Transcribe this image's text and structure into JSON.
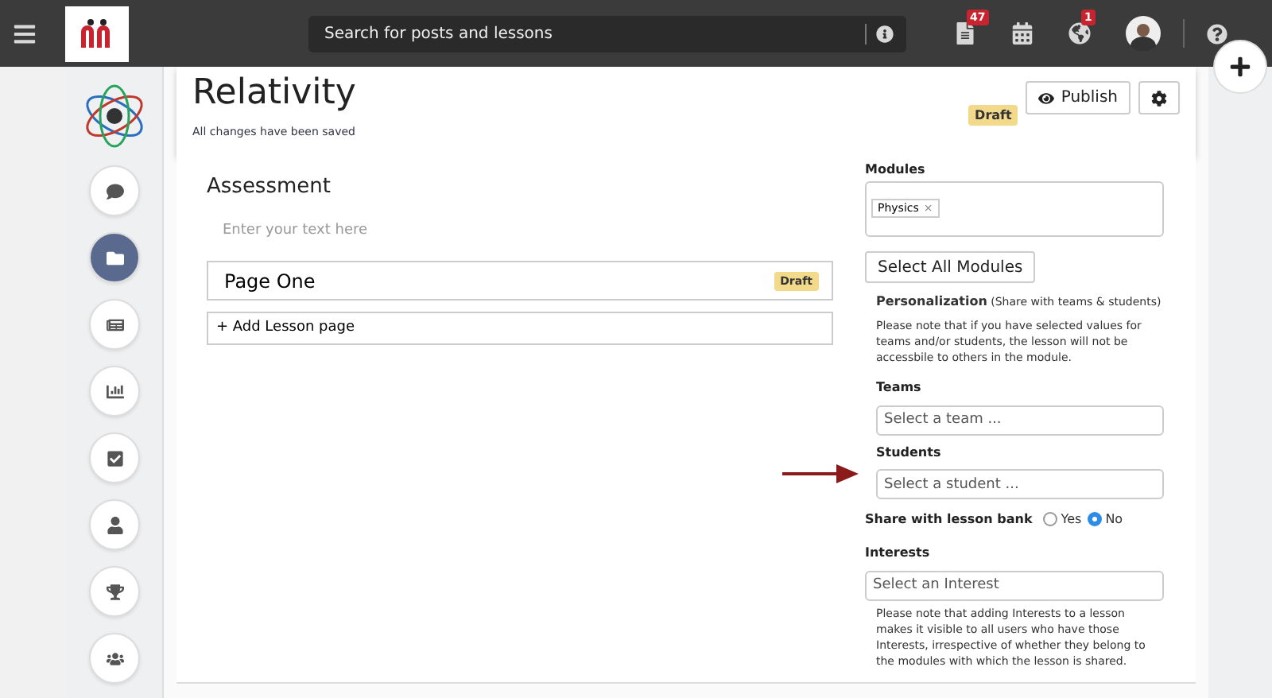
{
  "topbar": {
    "search": {
      "placeholder": "Search for posts and lessons"
    },
    "notifications": [
      {
        "kind": "document",
        "badge": "47"
      },
      {
        "kind": "calendar"
      },
      {
        "kind": "globe",
        "badge": "1"
      }
    ]
  },
  "sidebar": {
    "items": [
      {
        "kind": "chat",
        "selected": false
      },
      {
        "kind": "folder",
        "selected": true
      },
      {
        "kind": "newspaper",
        "selected": false
      },
      {
        "kind": "chart",
        "selected": false
      },
      {
        "kind": "tasks",
        "selected": false
      },
      {
        "kind": "user",
        "selected": false
      },
      {
        "kind": "trophy",
        "selected": false
      },
      {
        "kind": "users",
        "selected": false
      }
    ]
  },
  "lesson": {
    "title": "Relativity",
    "status": "Draft",
    "save_note": "All changes have been saved",
    "publish": "Publish"
  },
  "assessment": {
    "heading": "Assessment",
    "placeholder": "Enter your text here",
    "pages": [
      {
        "title": "Page One",
        "status": "Draft"
      }
    ],
    "add_page": "+ Add Lesson page"
  },
  "modules": {
    "label": "Modules",
    "tags": [
      {
        "label": "Physics",
        "remove": "×"
      }
    ],
    "select_all": "Select All Modules"
  },
  "personalization": {
    "heading": "**Personalization** (Share with teams & students)",
    "note": "Please note that if you have selected values for teams and/or students, the lesson will not be accessbile to others in the module.",
    "fields": [
      {
        "label": "Teams",
        "placeholder": "Select a team ..."
      },
      {
        "label": "Students",
        "placeholder": "Select a student ..."
      }
    ]
  },
  "share": {
    "label": "Share with lesson bank",
    "options": [
      {
        "label": "Yes",
        "selected": false
      },
      {
        "label": "No",
        "selected": true
      }
    ]
  },
  "interests": {
    "label": "Interests",
    "placeholder": "Select an Interest",
    "note": "Please note that adding Interests to a lesson makes it visible to all users who have those Interests, irrespective of whether they belong to the modules with which the lesson is shared."
  }
}
